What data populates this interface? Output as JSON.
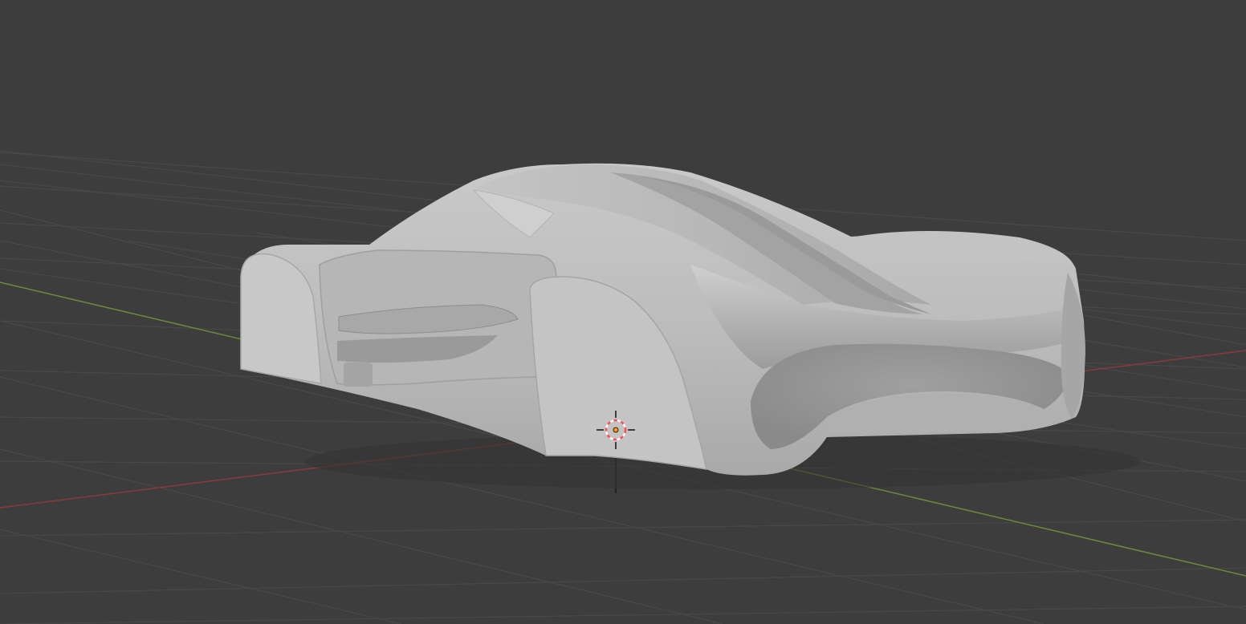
{
  "viewport": {
    "background_color": "#3d3d3d",
    "grid_color": "#4a4a4a",
    "x_axis_color": "#8a3a3a",
    "y_axis_color": "#6b8a3a",
    "z_axis_color": "#1c1c1c"
  },
  "scene": {
    "object": "sports-car-clay-model",
    "object_color": "#bdbdbd",
    "shading": "solid-matcap"
  },
  "cursor": {
    "icon": "3d-cursor-icon",
    "ring_color_primary": "#ff4d4d",
    "ring_color_secondary": "#ffffff",
    "origin_color": "#ff9a1a"
  }
}
